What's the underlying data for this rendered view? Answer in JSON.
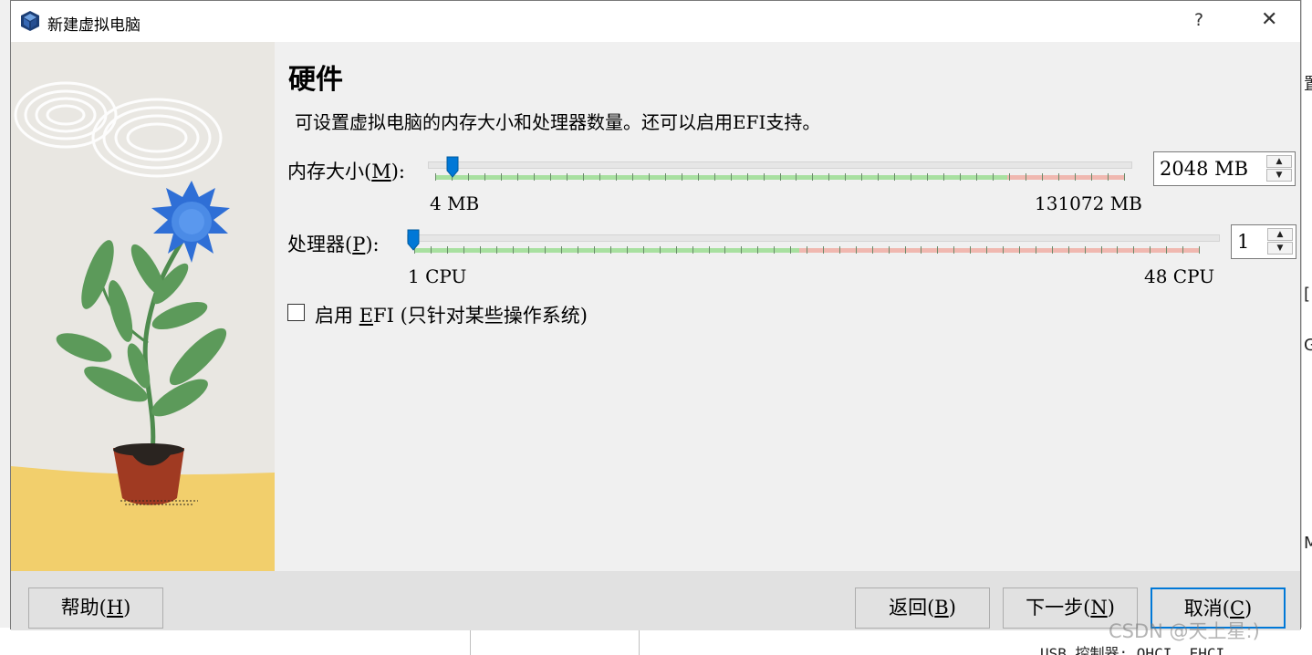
{
  "window": {
    "title": "新建虚拟电脑",
    "help_glyph": "?",
    "close_glyph": "✕"
  },
  "page": {
    "heading": "硬件",
    "description": "可设置虚拟电脑的内存大小和处理器数量。还可以启用EFI支持。"
  },
  "memory": {
    "label_pre": "内存大小(",
    "label_key": "M",
    "label_post": "):",
    "min_label": "4 MB",
    "max_label": "131072 MB",
    "value": "2048 MB",
    "level": 0.0156
  },
  "processor": {
    "label_pre": "处理器(",
    "label_key": "P",
    "label_post": "):",
    "min_label": "1 CPU",
    "max_label": "48 CPU",
    "value": "1",
    "level": 0.0
  },
  "efi": {
    "checked": false,
    "label_pre": "启用 ",
    "label_key": "E",
    "label_post": "FI (只针对某些操作系统)"
  },
  "buttons": {
    "help_pre": "帮助(",
    "help_key": "H",
    "back_pre": "返回(",
    "back_key": "B",
    "next_pre": "下一步(",
    "next_key": "N",
    "cancel_pre": "取消(",
    "cancel_key": "C",
    "close_paren": ")"
  },
  "background": {
    "right_chars": [
      "置",
      "[",
      "G",
      "M"
    ],
    "bottom_text": "USB 控制器: OHCI, EHCI"
  },
  "watermark": "CSDN @天上星:)",
  "colors": {
    "accent": "#0078d7",
    "slider_ok": "#a8e0a0",
    "slider_warn": "#f0b8b0",
    "pot": "#a03a22",
    "flower": "#2f6fd6",
    "leaf": "#4e8b4e",
    "ground": "#f2cf6c"
  }
}
